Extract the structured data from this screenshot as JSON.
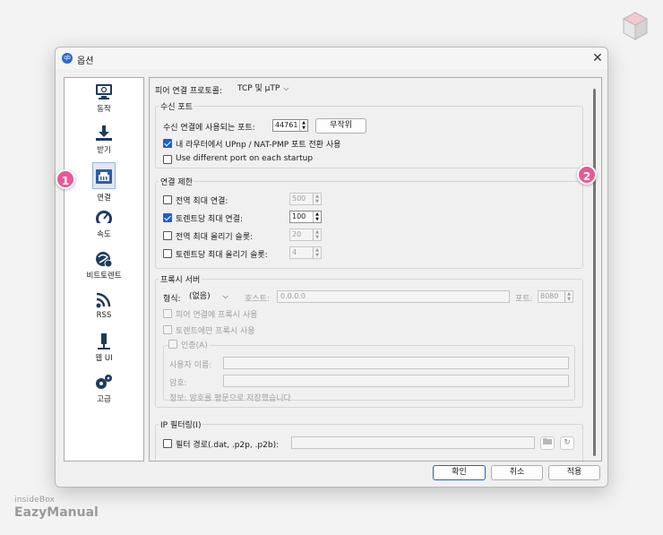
{
  "window": {
    "title": "옵션",
    "app_icon": "qbittorrent-icon",
    "close_glyph": "✕"
  },
  "sidebar": {
    "items": [
      {
        "label": "동작",
        "icon": "behavior-icon"
      },
      {
        "label": "받기",
        "icon": "download-icon"
      },
      {
        "label": "연결",
        "icon": "connection-icon",
        "active": true
      },
      {
        "label": "속도",
        "icon": "speedometer-icon"
      },
      {
        "label": "비트토렌트",
        "icon": "bittorrent-icon"
      },
      {
        "label": "RSS",
        "icon": "rss-icon"
      },
      {
        "label": "웹 UI",
        "icon": "web-ui-icon"
      },
      {
        "label": "고급",
        "icon": "advanced-gears-icon"
      }
    ]
  },
  "badges": {
    "one": "1",
    "two": "2"
  },
  "connection": {
    "protocol_label": "피어 연결 프로토콜:",
    "protocol_value": "TCP 및 μTP",
    "listening_port": {
      "title": "수신 포트",
      "port_label": "수신 연결에 사용되는 포트:",
      "port_value": "44761",
      "random_button": "무작위",
      "upnp_label": "내 라우터에서 UPnp / NAT-PMP 포트 전환 사용",
      "upnp_checked": true,
      "different_port_label": "Use different port on each startup",
      "different_port_checked": false
    },
    "limits": {
      "title": "연결 제한",
      "rows": [
        {
          "label": "전역 최대 연결:",
          "value": "500",
          "checked": false
        },
        {
          "label": "토렌트당 최대 연결:",
          "value": "100",
          "checked": true
        },
        {
          "label": "전역 최대 올리기 슬롯:",
          "value": "20",
          "checked": false
        },
        {
          "label": "토렌트당 최대 올리기 슬롯:",
          "value": "4",
          "checked": false
        }
      ]
    },
    "proxy": {
      "title": "프록시 서버",
      "type_label": "형식:",
      "type_value": "(없음)",
      "host_label": "호스트:",
      "host_value": "0.0.0.0",
      "port_label": "포트:",
      "port_value": "8080",
      "peer_proxy_label": "피어 연결에 프록시 사용",
      "torrent_only_label": "토렌트에만 프록시 사용",
      "auth_label": "인증(A)",
      "username_label": "사용자 이름:",
      "password_label": "암호:",
      "info_text": "정보: 암호를 평문으로 저장했습니다"
    },
    "ip_filter": {
      "title": "IP 필터링(I)",
      "filter_path_label": "필터 경로(.dat, .p2p, .p2b):"
    }
  },
  "footer": {
    "ok": "확인",
    "cancel": "취소",
    "apply": "적용"
  },
  "brand": {
    "line1": "insideBox",
    "line2": "EazyManual"
  },
  "colors": {
    "accent": "#1f5fc7",
    "badge": "#e65a97"
  }
}
